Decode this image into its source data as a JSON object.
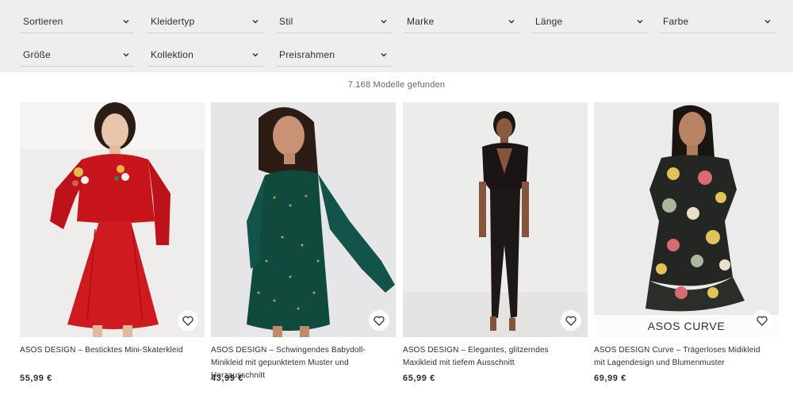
{
  "filters": [
    {
      "label": "Sortieren"
    },
    {
      "label": "Kleidertyp"
    },
    {
      "label": "Stil"
    },
    {
      "label": "Marke"
    },
    {
      "label": "Länge"
    },
    {
      "label": "Farbe"
    },
    {
      "label": "Größe"
    },
    {
      "label": "Kollektion"
    },
    {
      "label": "Preisrahmen"
    }
  ],
  "results": {
    "count_text": "7.168 Modelle gefunden"
  },
  "products": [
    {
      "title": "ASOS DESIGN – Besticktes Mini-Skaterkleid",
      "price": "55,99 €",
      "color": "#c8151b"
    },
    {
      "title": "ASOS DESIGN – Schwingendes Babydoll-Minikleid mit gepunktetem Muster und Herzausschnitt",
      "price": "43,99 €",
      "color": "#0f4a3d"
    },
    {
      "title": "ASOS DESIGN – Elegantes, glitzerndes Maxikleid mit tiefem Ausschnitt",
      "price": "65,99 €",
      "color": "#1a1414"
    },
    {
      "title": "ASOS DESIGN Curve – Trägerloses Midikleid mit Lagendesign und Blumenmuster",
      "price": "69,99 €",
      "color": "#232622",
      "badge": "ASOS CURVE"
    }
  ],
  "icons": {
    "filter_toggle": "chevron-down-icon",
    "wishlist": "heart-icon"
  }
}
